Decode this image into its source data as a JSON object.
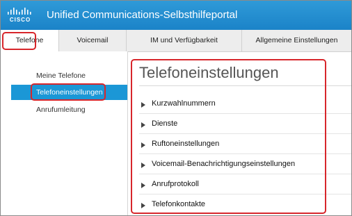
{
  "header": {
    "logo_text": "CISCO",
    "title": "Unified Communications-Selbsthilfeportal",
    "brand_color": "#1b83c8"
  },
  "tabs": [
    {
      "label": "Telefone",
      "active": true
    },
    {
      "label": "Voicemail",
      "active": false
    },
    {
      "label": "IM und Verfügbarkeit",
      "active": false
    },
    {
      "label": "Allgemeine Einstellungen",
      "active": false
    }
  ],
  "sidebar": {
    "items": [
      {
        "label": "Meine Telefone",
        "selected": false
      },
      {
        "label": "Telefoneinstellungen",
        "selected": true
      },
      {
        "label": "Anrufumleitung",
        "selected": false
      }
    ]
  },
  "main": {
    "title": "Telefoneinstellungen",
    "sections": [
      {
        "label": "Kurzwahlnummern",
        "icon": "triangle-right-icon"
      },
      {
        "label": "Dienste",
        "icon": "triangle-right-icon"
      },
      {
        "label": "Ruftoneinstellungen",
        "icon": "triangle-right-icon"
      },
      {
        "label": "Voicemail-Benachrichtigungseinstellungen",
        "icon": "triangle-right-icon"
      },
      {
        "label": "Anrufprotokoll",
        "icon": "triangle-right-icon"
      },
      {
        "label": "Telefonkontakte",
        "icon": "triangle-right-icon"
      }
    ]
  },
  "annotations": {
    "highlight_color": "#d7262b"
  }
}
